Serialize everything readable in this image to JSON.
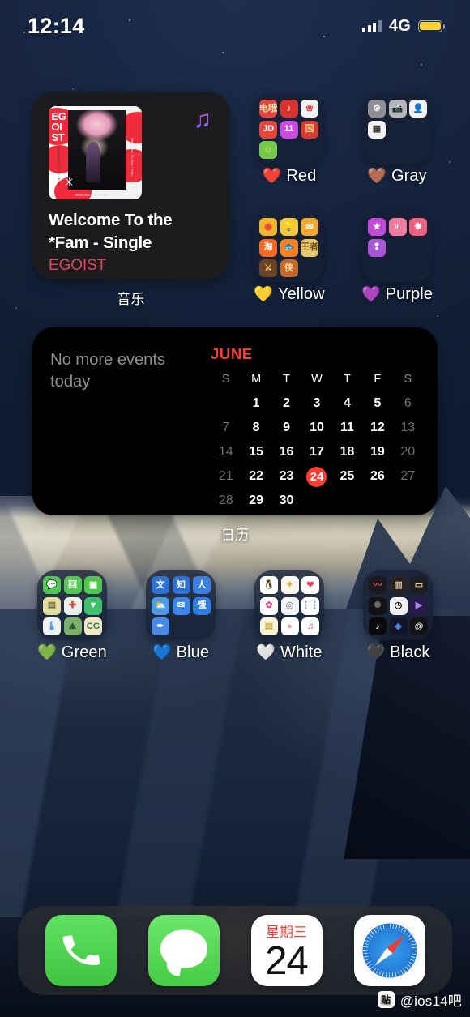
{
  "status_bar": {
    "time": "12:14",
    "network": "4G",
    "battery_color": "#fcd535"
  },
  "music_widget": {
    "album_art_text": "EG\nOI\nST",
    "album_art_side_text": "Welcome To the *Fam",
    "album_art_side_text2": "Welcome To the *Fam",
    "album_art_bottom_text": "Welcome to the *fam",
    "album_art_star": "✳",
    "title": "Welcome To the\n*Fam - Single",
    "title_line1": "Welcome To the",
    "title_line2": "*Fam - Single",
    "artist": "EGOIST",
    "artist_color": "#e1435a",
    "app_icon": "music-note-icon",
    "caption": "音乐"
  },
  "calendar_widget": {
    "no_events_text": "No more events\ntoday",
    "no_events_line1": "No more events",
    "no_events_line2": "today",
    "month": "JUNE",
    "month_color": "#ff3b30",
    "day_headers": [
      "S",
      "M",
      "T",
      "W",
      "T",
      "F",
      "S"
    ],
    "weeks": [
      [
        "",
        "1",
        "2",
        "3",
        "4",
        "5",
        "6"
      ],
      [
        "7",
        "8",
        "9",
        "10",
        "11",
        "12",
        "13"
      ],
      [
        "14",
        "15",
        "16",
        "17",
        "18",
        "19",
        "20"
      ],
      [
        "21",
        "22",
        "23",
        "24",
        "25",
        "26",
        "27"
      ],
      [
        "28",
        "29",
        "30",
        "",
        "",
        "",
        ""
      ]
    ],
    "today": "24",
    "today_highlight_color": "#ff3b30",
    "caption": "日历"
  },
  "folders": [
    {
      "name": "Red",
      "heart": "❤️",
      "heart_color": "#e8192c",
      "icons": [
        {
          "name": "netease-cloud-music-icon",
          "glyph": "电哦",
          "bg": "#e8433f",
          "fg": "#ffe9b0"
        },
        {
          "name": "netease-music-icon",
          "glyph": "♪",
          "bg": "#d8342f",
          "fg": "#ffffff"
        },
        {
          "name": "red-flower-app-icon",
          "glyph": "❀",
          "bg": "#f2f2f2",
          "fg": "#e03a3a"
        },
        {
          "name": "jd-app-icon",
          "glyph": "JD",
          "bg": "#e8453c",
          "fg": "#ffffff"
        },
        {
          "name": "tmall-rainbow-icon",
          "glyph": "11",
          "bg": "#c94be0",
          "fg": "#ffffff"
        },
        {
          "name": "china-red-app-icon",
          "glyph": "国",
          "bg": "#d63a30",
          "fg": "#ffd98a"
        },
        {
          "name": "rainbow-emoji-app-icon",
          "glyph": "☺",
          "bg": "#72c94a",
          "fg": "#ffe14d"
        }
      ]
    },
    {
      "name": "Gray",
      "heart": "🤎",
      "heart_color": "#9a6434",
      "icons": [
        {
          "name": "settings-icon",
          "glyph": "⚙",
          "bg": "#8e8e93",
          "fg": "#f2f2f2"
        },
        {
          "name": "camera-icon",
          "glyph": "📷",
          "bg": "#b5b5ba",
          "fg": "#3a3a3c"
        },
        {
          "name": "contacts-icon",
          "glyph": "👤",
          "bg": "#f4f2ee",
          "fg": "#8a7a5f"
        },
        {
          "name": "calculator-icon",
          "glyph": "▦",
          "bg": "#f2f2f2",
          "fg": "#3a3a3c"
        }
      ]
    },
    {
      "name": "Yellow",
      "heart": "💛",
      "heart_color": "#f5c84b",
      "icons": [
        {
          "name": "weibo-icon",
          "glyph": "◉",
          "bg": "#f3b428",
          "fg": "#e8453c"
        },
        {
          "name": "lightbulb-app-icon",
          "glyph": "💡",
          "bg": "#f7c73c",
          "fg": "#ffffff"
        },
        {
          "name": "mail-icon",
          "glyph": "✉",
          "bg": "#f2a72e",
          "fg": "#ffffff"
        },
        {
          "name": "taobao-icon",
          "glyph": "淘",
          "bg": "#f36a1e",
          "fg": "#ffffff"
        },
        {
          "name": "xianyu-icon",
          "glyph": "🐟",
          "bg": "#f4811f",
          "fg": "#ffffff"
        },
        {
          "name": "yellow-game-icon",
          "glyph": "王者",
          "bg": "#e8c96a",
          "fg": "#6b4a1c"
        },
        {
          "name": "game-app-icon-1",
          "glyph": "⚔",
          "bg": "#6d4423",
          "fg": "#f0c06a"
        },
        {
          "name": "game-app-icon-2",
          "glyph": "侠",
          "bg": "#c2682a",
          "fg": "#ffe2a8"
        }
      ]
    },
    {
      "name": "Purple",
      "heart": "💜",
      "heart_color": "#a855f7",
      "icons": [
        {
          "name": "star-app-icon",
          "glyph": "★",
          "bg": "#c24ad6",
          "fg": "#ffffff"
        },
        {
          "name": "bilibili-icon",
          "glyph": "ili",
          "bg": "#f07a9d",
          "fg": "#ffffff"
        },
        {
          "name": "flower-app-icon",
          "glyph": "❋",
          "bg": "#ef5f7e",
          "fg": "#ffffff"
        },
        {
          "name": "twitch-icon",
          "glyph": "❢",
          "bg": "#a855d6",
          "fg": "#ffffff"
        }
      ]
    },
    {
      "name": "Green",
      "heart": "💚",
      "heart_color": "#4cd964",
      "icons": [
        {
          "name": "wechat-icon",
          "glyph": "💬",
          "bg": "#4fc94f",
          "fg": "#ffffff"
        },
        {
          "name": "qq-green-icon",
          "glyph": "回",
          "bg": "#54c94f",
          "fg": "#ffffff"
        },
        {
          "name": "facetime-icon",
          "glyph": "▣",
          "bg": "#4ec94e",
          "fg": "#ffffff"
        },
        {
          "name": "notes-green-icon",
          "glyph": "▤",
          "bg": "#e3dfa0",
          "fg": "#6b6a3a"
        },
        {
          "name": "green-tool-icon",
          "glyph": "✚",
          "bg": "#eaf0ea",
          "fg": "#d84a4a"
        },
        {
          "name": "green-app-icon",
          "glyph": "▼",
          "bg": "#3fbf6a",
          "fg": "#ffffff"
        },
        {
          "name": "health-icon",
          "glyph": "🌡",
          "bg": "#eef2f4",
          "fg": "#4a9ad8"
        },
        {
          "name": "landscape-app-icon",
          "glyph": "⛰",
          "bg": "#7fb06a",
          "fg": "#2a5a3a"
        },
        {
          "name": "cg-app-icon",
          "glyph": "CG",
          "bg": "#f0e6c8",
          "fg": "#3a7a4a"
        }
      ]
    },
    {
      "name": "Blue",
      "heart": "💙",
      "heart_color": "#3478f6",
      "icons": [
        {
          "name": "wenyan-app-icon",
          "glyph": "文",
          "bg": "#2f73d8",
          "fg": "#ffffff"
        },
        {
          "name": "zhihu-icon",
          "glyph": "知",
          "bg": "#2f6fd8",
          "fg": "#ffffff"
        },
        {
          "name": "translate-icon",
          "glyph": "人",
          "bg": "#3a7fe0",
          "fg": "#ffffff"
        },
        {
          "name": "weather-icon",
          "glyph": "⛅",
          "bg": "#4a9ae8",
          "fg": "#ffffff"
        },
        {
          "name": "mail-blue-icon",
          "glyph": "✉",
          "bg": "#3a86ea",
          "fg": "#ffffff"
        },
        {
          "name": "ele-icon",
          "glyph": "饿",
          "bg": "#2f7de0",
          "fg": "#ffffff"
        },
        {
          "name": "pen-app-icon",
          "glyph": "✒",
          "bg": "#4a8ae0",
          "fg": "#ffffff"
        }
      ]
    },
    {
      "name": "White",
      "heart": "🤍",
      "heart_color": "#f2f2f2",
      "icons": [
        {
          "name": "qq-icon",
          "glyph": "🐧",
          "bg": "#ffffff",
          "fg": "#1a1a1a"
        },
        {
          "name": "shortcuts-icon",
          "glyph": "✦",
          "bg": "#fbf6ee",
          "fg": "#f0a830"
        },
        {
          "name": "health-heart-icon",
          "glyph": "❤",
          "bg": "#ffffff",
          "fg": "#f2384c"
        },
        {
          "name": "photos-icon",
          "glyph": "✿",
          "bg": "#ffffff",
          "fg": "#e04a8a"
        },
        {
          "name": "app-store-icon",
          "glyph": "◎",
          "bg": "#f4f4f6",
          "fg": "#9a9aa0"
        },
        {
          "name": "settings-list-icon",
          "glyph": "⋮⋮",
          "bg": "#ffffff",
          "fg": "#5a8ad8"
        },
        {
          "name": "notes-icon",
          "glyph": "▤",
          "bg": "#fcf6d8",
          "fg": "#c8b048"
        },
        {
          "name": "sphere-app-icon",
          "glyph": "●",
          "bg": "#ffffff",
          "fg": "#e8a0b8"
        },
        {
          "name": "apple-music-icon",
          "glyph": "♫",
          "bg": "#ffffff",
          "fg": "#f0485e"
        }
      ]
    },
    {
      "name": "Black",
      "heart": "🖤",
      "heart_color": "#2a2a2a",
      "icons": [
        {
          "name": "voice-memos-icon",
          "glyph": "〰",
          "bg": "#1a1a1c",
          "fg": "#e8453c"
        },
        {
          "name": "piano-app-icon",
          "glyph": "▥",
          "bg": "#2a2420",
          "fg": "#d8c8a8"
        },
        {
          "name": "wallet-icon",
          "glyph": "▭",
          "bg": "#1e1e20",
          "fg": "#e8c88a"
        },
        {
          "name": "dark-app-icon",
          "glyph": "✺",
          "bg": "#121214",
          "fg": "#6a6a72"
        },
        {
          "name": "clock-icon",
          "glyph": "◷",
          "bg": "#f2f2f2",
          "fg": "#111111"
        },
        {
          "name": "video-app-icon",
          "glyph": "▶",
          "bg": "#2a1a4a",
          "fg": "#a88ae8"
        },
        {
          "name": "tiktok-icon",
          "glyph": "♪",
          "bg": "#0a0a0c",
          "fg": "#ffffff"
        },
        {
          "name": "shazam-icon",
          "glyph": "◈",
          "bg": "#141428",
          "fg": "#4a8ae8"
        },
        {
          "name": "threads-icon",
          "glyph": "@",
          "bg": "#141416",
          "fg": "#e8e8ea"
        }
      ]
    }
  ],
  "dock": [
    {
      "name": "phone-app",
      "label": "Phone"
    },
    {
      "name": "messages-app",
      "label": "Messages"
    },
    {
      "name": "calendar-app",
      "label": "Calendar",
      "weekday": "星期三",
      "day": "24"
    },
    {
      "name": "safari-app",
      "label": "Safari"
    }
  ],
  "watermark": {
    "badge": "贴",
    "text": "@ios14吧"
  }
}
